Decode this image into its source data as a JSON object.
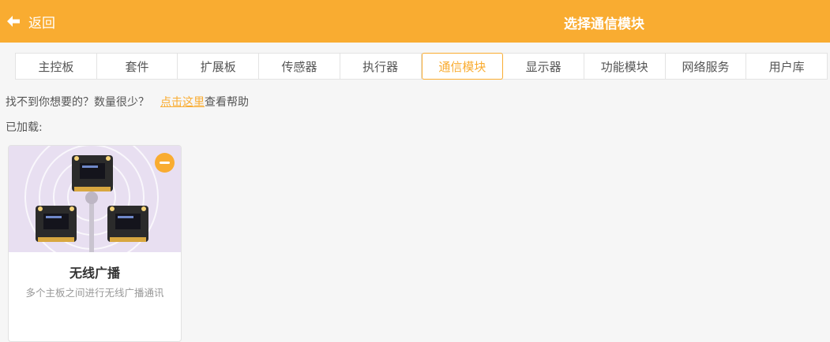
{
  "header": {
    "back_label": "返回",
    "title": "选择通信模块",
    "bar_color": "#f9ac31"
  },
  "tabs": [
    {
      "label": "主控板",
      "active": false
    },
    {
      "label": "套件",
      "active": false
    },
    {
      "label": "扩展板",
      "active": false
    },
    {
      "label": "传感器",
      "active": false
    },
    {
      "label": "执行器",
      "active": false
    },
    {
      "label": "通信模块",
      "active": true
    },
    {
      "label": "显示器",
      "active": false
    },
    {
      "label": "功能模块",
      "active": false
    },
    {
      "label": "网络服务",
      "active": false
    },
    {
      "label": "用户库",
      "active": false
    }
  ],
  "help": {
    "prefix": "找不到你想要的？数量很少？",
    "link": "点击这里",
    "suffix": "查看帮助"
  },
  "loaded_label": "已加载:",
  "modules": [
    {
      "name": "无线广播",
      "description": "多个主板之间进行无线广播通讯",
      "image_icon": "microbit-broadcast-illustration",
      "action_icon": "minus-icon"
    }
  ]
}
